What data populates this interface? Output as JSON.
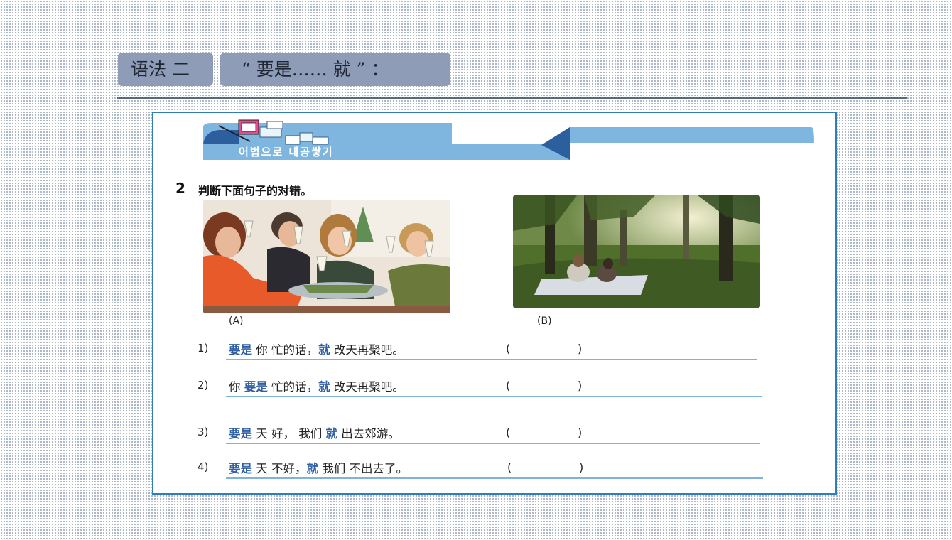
{
  "header": {
    "section": "语法 二",
    "pattern": "“ 要是…… 就 ” ："
  },
  "exercise": {
    "banner_text": "어법으로 내공쌓기",
    "number": "2",
    "instruction": "判断下面句子的对错。",
    "images": [
      {
        "caption": "(A)",
        "description_icon": "people-toasting-photo"
      },
      {
        "caption": "(B)",
        "description_icon": "forest-picnic-photo"
      }
    ],
    "items": [
      {
        "num": "1)",
        "parts": [
          "要是",
          " 你 忙的话，",
          "就",
          " 改天再聚吧。"
        ],
        "paren_open": "(",
        "paren_close": ")"
      },
      {
        "num": "2)",
        "parts": [
          "你 ",
          "要是",
          " 忙的话，",
          "就",
          " 改天再聚吧。"
        ],
        "paren_open": "(",
        "paren_close": ")"
      },
      {
        "num": "3)",
        "parts": [
          "要是",
          " 天 好， 我们 ",
          "就",
          " 出去郊游。"
        ],
        "paren_open": "(",
        "paren_close": ")"
      },
      {
        "num": "4)",
        "parts": [
          "要是",
          " 天 不好，",
          "就",
          " 我们 不出去了。"
        ],
        "paren_open": "(",
        "paren_close": ")"
      }
    ]
  },
  "colors": {
    "tag_bg": "#8e9cb8",
    "rule": "#566a80",
    "card_border": "#2f7db9",
    "keyword": "#2f5fa4",
    "banner_light": "#7fb6e0",
    "banner_dark": "#2d5e9e"
  }
}
